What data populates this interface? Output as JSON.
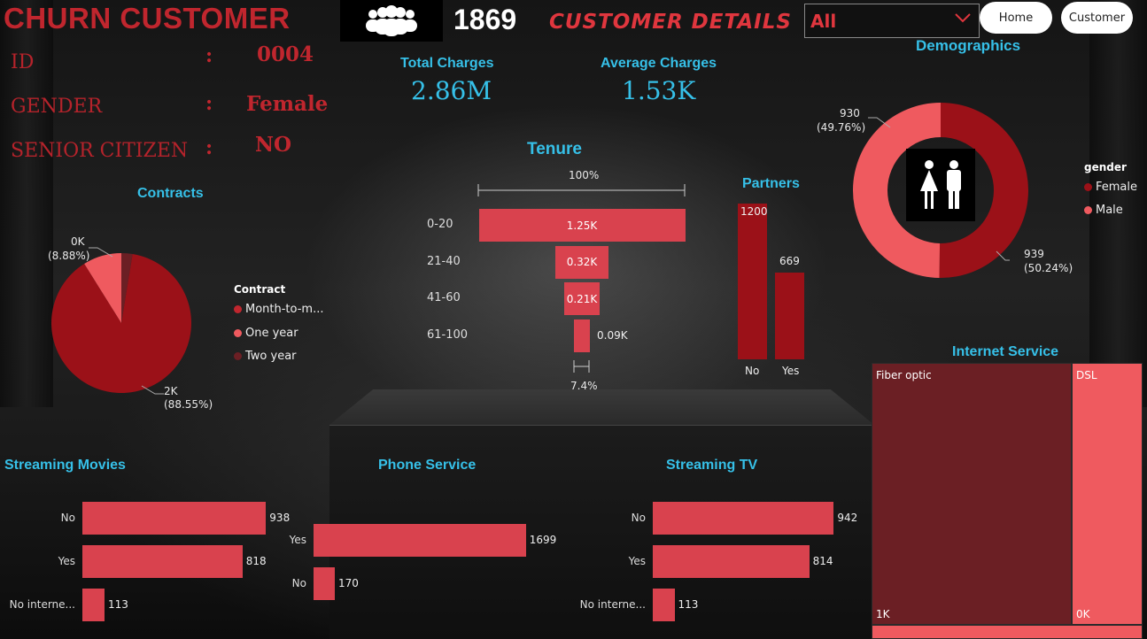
{
  "header": {
    "title": "CHURN CUSTOMER",
    "customer_count": "1869",
    "details_title": "CUSTOMER DETAILS",
    "slicer_value": "All",
    "nav": {
      "home": "Home",
      "customer": "Customer"
    }
  },
  "customer_info": [
    {
      "label": "ID",
      "value": "0004"
    },
    {
      "label": "GENDER",
      "value": "Female"
    },
    {
      "label": "SENIOR CITIZEN",
      "value": "NO"
    }
  ],
  "kpis": {
    "total_charges": {
      "label": "Total Charges",
      "value": "2.86M"
    },
    "average_charges": {
      "label": "Average Charges",
      "value": "1.53K"
    }
  },
  "colors": {
    "accent_blue": "#36c0e8",
    "dark_red": "#9b1118",
    "red": "#d9424e",
    "light_red": "#ef5a5f",
    "maroon": "#6b1f24"
  },
  "chart_data": [
    {
      "id": "contracts",
      "type": "pie",
      "title": "Contracts",
      "legend_title": "Contract",
      "legend_placement": "right",
      "series": [
        {
          "name": "Month-to-m...",
          "value": 1655,
          "percent": "(88.55%)",
          "label": "2K",
          "color": "#9b1118"
        },
        {
          "name": "One year",
          "value": 166,
          "percent": "(8.88%)",
          "label": "0K",
          "color": "#ef5a5f"
        },
        {
          "name": "Two year",
          "value": 48,
          "color": "#6b1f24"
        }
      ]
    },
    {
      "id": "tenure",
      "type": "bar",
      "title": "Tenure",
      "top_label": "100%",
      "bottom_label": "7.4%",
      "categories": [
        "0-20",
        "21-40",
        "41-60",
        "61-100"
      ],
      "values": [
        1250,
        320,
        210,
        90
      ],
      "labels": [
        "1.25K",
        "0.32K",
        "0.21K",
        "0.09K"
      ]
    },
    {
      "id": "partners",
      "type": "bar",
      "title": "Partners",
      "categories": [
        "No",
        "Yes"
      ],
      "values": [
        1200,
        669
      ],
      "labels": [
        "1200",
        "669"
      ]
    },
    {
      "id": "demographics",
      "type": "pie",
      "title": "Demographics",
      "legend_title": "gender",
      "legend_placement": "right",
      "series": [
        {
          "name": "Female",
          "value": 939,
          "percent": "(50.24%)",
          "color": "#9b1118"
        },
        {
          "name": "Male",
          "value": 930,
          "percent": "(49.76%)",
          "color": "#ef5a5f"
        }
      ]
    },
    {
      "id": "internet_service",
      "type": "heatmap",
      "title": "Internet Service",
      "series": [
        {
          "name": "Fiber optic",
          "value": 1297,
          "label": "1K",
          "color": "#6b1f24"
        },
        {
          "name": "DSL",
          "value": 459,
          "label": "0K",
          "color": "#ef5a5f"
        },
        {
          "name": "",
          "value": 113,
          "color": "#ef5a5f"
        }
      ]
    },
    {
      "id": "streaming_movies",
      "type": "bar",
      "title": "Streaming Movies",
      "categories": [
        "No",
        "Yes",
        "No interne..."
      ],
      "values": [
        938,
        818,
        113
      ],
      "xlim": [
        0,
        1000
      ]
    },
    {
      "id": "phone_service",
      "type": "bar",
      "title": "Phone Service",
      "categories": [
        "Yes",
        "No"
      ],
      "values": [
        1699,
        170
      ],
      "xlim": [
        0,
        1800
      ]
    },
    {
      "id": "streaming_tv",
      "type": "bar",
      "title": "Streaming TV",
      "categories": [
        "No",
        "Yes",
        "No interne..."
      ],
      "values": [
        942,
        814,
        113
      ],
      "xlim": [
        0,
        1000
      ]
    }
  ]
}
